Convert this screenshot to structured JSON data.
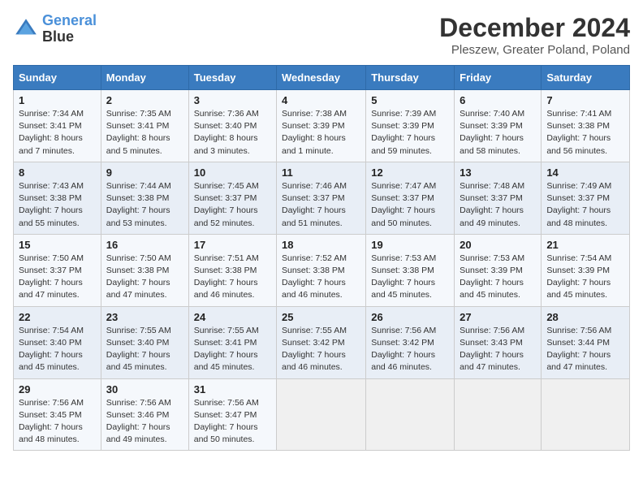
{
  "header": {
    "logo_line1": "General",
    "logo_line2": "Blue",
    "title": "December 2024",
    "subtitle": "Pleszew, Greater Poland, Poland"
  },
  "calendar": {
    "days_of_week": [
      "Sunday",
      "Monday",
      "Tuesday",
      "Wednesday",
      "Thursday",
      "Friday",
      "Saturday"
    ],
    "weeks": [
      [
        {
          "day": "1",
          "info": "Sunrise: 7:34 AM\nSunset: 3:41 PM\nDaylight: 8 hours and 7 minutes."
        },
        {
          "day": "2",
          "info": "Sunrise: 7:35 AM\nSunset: 3:41 PM\nDaylight: 8 hours and 5 minutes."
        },
        {
          "day": "3",
          "info": "Sunrise: 7:36 AM\nSunset: 3:40 PM\nDaylight: 8 hours and 3 minutes."
        },
        {
          "day": "4",
          "info": "Sunrise: 7:38 AM\nSunset: 3:39 PM\nDaylight: 8 hours and 1 minute."
        },
        {
          "day": "5",
          "info": "Sunrise: 7:39 AM\nSunset: 3:39 PM\nDaylight: 7 hours and 59 minutes."
        },
        {
          "day": "6",
          "info": "Sunrise: 7:40 AM\nSunset: 3:39 PM\nDaylight: 7 hours and 58 minutes."
        },
        {
          "day": "7",
          "info": "Sunrise: 7:41 AM\nSunset: 3:38 PM\nDaylight: 7 hours and 56 minutes."
        }
      ],
      [
        {
          "day": "8",
          "info": "Sunrise: 7:43 AM\nSunset: 3:38 PM\nDaylight: 7 hours and 55 minutes."
        },
        {
          "day": "9",
          "info": "Sunrise: 7:44 AM\nSunset: 3:38 PM\nDaylight: 7 hours and 53 minutes."
        },
        {
          "day": "10",
          "info": "Sunrise: 7:45 AM\nSunset: 3:37 PM\nDaylight: 7 hours and 52 minutes."
        },
        {
          "day": "11",
          "info": "Sunrise: 7:46 AM\nSunset: 3:37 PM\nDaylight: 7 hours and 51 minutes."
        },
        {
          "day": "12",
          "info": "Sunrise: 7:47 AM\nSunset: 3:37 PM\nDaylight: 7 hours and 50 minutes."
        },
        {
          "day": "13",
          "info": "Sunrise: 7:48 AM\nSunset: 3:37 PM\nDaylight: 7 hours and 49 minutes."
        },
        {
          "day": "14",
          "info": "Sunrise: 7:49 AM\nSunset: 3:37 PM\nDaylight: 7 hours and 48 minutes."
        }
      ],
      [
        {
          "day": "15",
          "info": "Sunrise: 7:50 AM\nSunset: 3:37 PM\nDaylight: 7 hours and 47 minutes."
        },
        {
          "day": "16",
          "info": "Sunrise: 7:50 AM\nSunset: 3:38 PM\nDaylight: 7 hours and 47 minutes."
        },
        {
          "day": "17",
          "info": "Sunrise: 7:51 AM\nSunset: 3:38 PM\nDaylight: 7 hours and 46 minutes."
        },
        {
          "day": "18",
          "info": "Sunrise: 7:52 AM\nSunset: 3:38 PM\nDaylight: 7 hours and 46 minutes."
        },
        {
          "day": "19",
          "info": "Sunrise: 7:53 AM\nSunset: 3:38 PM\nDaylight: 7 hours and 45 minutes."
        },
        {
          "day": "20",
          "info": "Sunrise: 7:53 AM\nSunset: 3:39 PM\nDaylight: 7 hours and 45 minutes."
        },
        {
          "day": "21",
          "info": "Sunrise: 7:54 AM\nSunset: 3:39 PM\nDaylight: 7 hours and 45 minutes."
        }
      ],
      [
        {
          "day": "22",
          "info": "Sunrise: 7:54 AM\nSunset: 3:40 PM\nDaylight: 7 hours and 45 minutes."
        },
        {
          "day": "23",
          "info": "Sunrise: 7:55 AM\nSunset: 3:40 PM\nDaylight: 7 hours and 45 minutes."
        },
        {
          "day": "24",
          "info": "Sunrise: 7:55 AM\nSunset: 3:41 PM\nDaylight: 7 hours and 45 minutes."
        },
        {
          "day": "25",
          "info": "Sunrise: 7:55 AM\nSunset: 3:42 PM\nDaylight: 7 hours and 46 minutes."
        },
        {
          "day": "26",
          "info": "Sunrise: 7:56 AM\nSunset: 3:42 PM\nDaylight: 7 hours and 46 minutes."
        },
        {
          "day": "27",
          "info": "Sunrise: 7:56 AM\nSunset: 3:43 PM\nDaylight: 7 hours and 47 minutes."
        },
        {
          "day": "28",
          "info": "Sunrise: 7:56 AM\nSunset: 3:44 PM\nDaylight: 7 hours and 47 minutes."
        }
      ],
      [
        {
          "day": "29",
          "info": "Sunrise: 7:56 AM\nSunset: 3:45 PM\nDaylight: 7 hours and 48 minutes."
        },
        {
          "day": "30",
          "info": "Sunrise: 7:56 AM\nSunset: 3:46 PM\nDaylight: 7 hours and 49 minutes."
        },
        {
          "day": "31",
          "info": "Sunrise: 7:56 AM\nSunset: 3:47 PM\nDaylight: 7 hours and 50 minutes."
        },
        null,
        null,
        null,
        null
      ]
    ]
  }
}
